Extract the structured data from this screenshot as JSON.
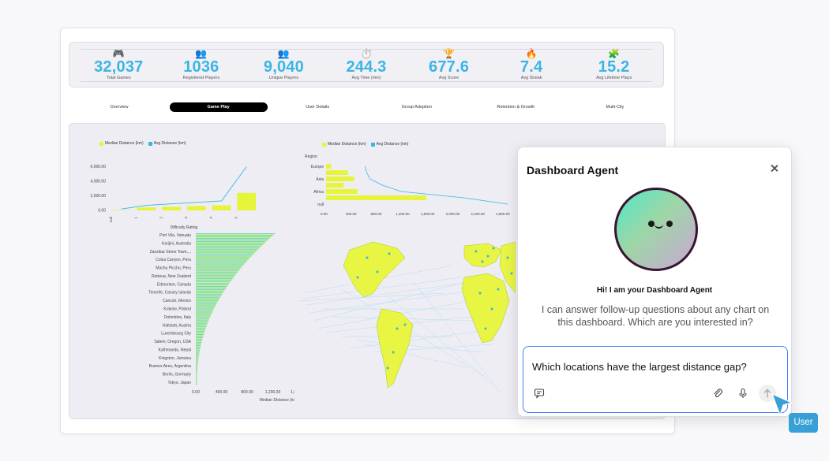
{
  "kpis": [
    {
      "icon": "🎮",
      "icon_name": "gamepad-icon",
      "value": "32,037",
      "label": "Total Games"
    },
    {
      "icon": "👥",
      "icon_name": "users-icon",
      "value": "1036",
      "label": "Registered Players"
    },
    {
      "icon": "👥",
      "icon_name": "users-icon",
      "value": "9,040",
      "label": "Unique Players"
    },
    {
      "icon": "⏱️",
      "icon_name": "stopwatch-icon",
      "value": "244.3",
      "label": "Avg Time (min)"
    },
    {
      "icon": "🏆",
      "icon_name": "trophy-icon",
      "value": "677.6",
      "label": "Avg Score"
    },
    {
      "icon": "🔥",
      "icon_name": "fire-icon",
      "value": "7.4",
      "label": "Avg Streak"
    },
    {
      "icon": "🧩",
      "icon_name": "puzzle-icon",
      "value": "15.2",
      "label": "Avg Lifetime Plays"
    }
  ],
  "tabs": [
    {
      "label": "Overview",
      "active": false
    },
    {
      "label": "Game Play",
      "active": true
    },
    {
      "label": "User Details",
      "active": false
    },
    {
      "label": "Group Adoption",
      "active": false
    },
    {
      "label": "Retention & Growth",
      "active": false
    },
    {
      "label": "Multi-City",
      "active": false
    }
  ],
  "colors": {
    "accent": "#3ab5e6",
    "median": "#e6f53a",
    "avg": "#3ab5e6",
    "chat_border": "#3b82f6",
    "user_tag": "#37a0d6"
  },
  "chart_data": [
    {
      "type": "bar",
      "legend": [
        "Median Distance (km)",
        "Avg Distance (km)"
      ],
      "categories": [
        "null",
        "1",
        "2",
        "3",
        "4",
        "5"
      ],
      "series": [
        {
          "name": "Median Distance (km)",
          "type": "bar",
          "values": [
            50,
            400,
            500,
            600,
            700,
            2400
          ]
        },
        {
          "name": "Avg Distance (km)",
          "type": "line",
          "values": [
            200,
            700,
            900,
            1100,
            1300,
            6000
          ]
        }
      ],
      "xlabel": "Difficulty Rating",
      "ylabel": "",
      "yticks": [
        "0.00",
        "2,000.00",
        "4,000.00",
        "6,000.00"
      ],
      "ylim": [
        0,
        6500
      ]
    },
    {
      "type": "bar",
      "orientation": "horizontal",
      "legend": [
        "Median Distance (km)",
        "Avg Distance (km)"
      ],
      "axis_title": "Region",
      "categories": [
        "Europe",
        "",
        "Asia",
        "",
        "Africa",
        "",
        "null"
      ],
      "series": [
        {
          "name": "Median Distance (km)",
          "type": "bar",
          "values": [
            80,
            350,
            450,
            280,
            500,
            1600,
            0
          ]
        },
        {
          "name": "Avg Distance (km)",
          "type": "line",
          "values": [
            620,
            650,
            700,
            900,
            1200,
            2200,
            2900
          ]
        }
      ],
      "xticks": [
        "0.00",
        "400.00",
        "800.00",
        "1,200.00",
        "1,600.00",
        "2,000.00",
        "2,400.00",
        "2,800.00"
      ],
      "xlim": [
        0,
        2900
      ]
    },
    {
      "type": "bar",
      "orientation": "horizontal",
      "categories": [
        "Port Vila, Vanuatu",
        "Karijini, Australia",
        "Zanzibar Stone Town,...",
        "Colca Canyon, Peru",
        "Machu Picchu, Peru",
        "Rotorua, New Zealand",
        "Edmonton, Canada",
        "Tenerife, Canary Islands",
        "Cancún, Mexico",
        "Kraków, Poland",
        "Dolomites, Italy",
        "Hallstatt, Austria",
        "Luxembourg City",
        "Salem, Oregon, USA",
        "Kathmandu, Nepal",
        "Kingston, Jamaica",
        "Buenos Aires, Argentina",
        "Berlin, Germany",
        "Tokyo, Japan"
      ],
      "series": [
        {
          "name": "Median Distance (km)",
          "values": [
            2900,
            2650,
            2400,
            2150,
            1950,
            1750,
            1550,
            1400,
            1250,
            1100,
            980,
            870,
            760,
            650,
            560,
            470,
            380,
            250,
            60
          ]
        }
      ],
      "xlabel": "Median Distance (km)",
      "xticks": [
        "0.00",
        "400.00",
        "800.00",
        "1,200.00",
        "1,600.00",
        "2,000.00",
        "2,400.00",
        "2,800.00"
      ],
      "xlim": [
        0,
        3000
      ]
    }
  ],
  "chat": {
    "title": "Dashboard Agent",
    "greeting": "Hi! I am your Dashboard Agent",
    "intro": "I can answer follow-up questions about any chart on this dashboard. Which are you interested in?",
    "input_value": "Which locations have the largest distance gap?"
  },
  "user_tag": "User"
}
